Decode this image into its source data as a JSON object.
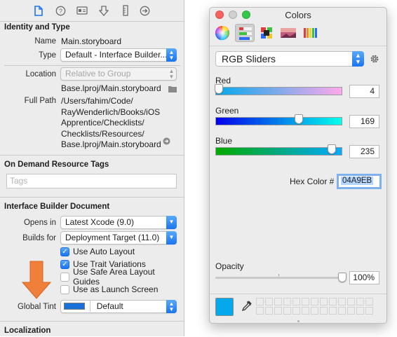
{
  "inspector": {
    "identity": {
      "header": "Identity and Type",
      "name_label": "Name",
      "name_value": "Main.storyboard",
      "type_label": "Type",
      "type_value": "Default - Interface Builder...",
      "location_label": "Location",
      "location_value": "Relative to Group",
      "location_path": "Base.lproj/Main.storyboard",
      "fullpath_label": "Full Path",
      "fullpath_lines": [
        "/Users/fahim/Code/",
        "RayWenderlich/Books/iOS",
        "Apprentice/Checklists/",
        "Checklists/Resources/",
        "Base.lproj/Main.storyboard"
      ]
    },
    "on_demand": {
      "header": "On Demand Resource Tags",
      "tags_placeholder": "Tags"
    },
    "ib_document": {
      "header": "Interface Builder Document",
      "opens_in_label": "Opens in",
      "opens_in_value": "Latest Xcode (9.0)",
      "builds_for_label": "Builds for",
      "builds_for_value": "Deployment Target (11.0)",
      "checkboxes": [
        {
          "label": "Use Auto Layout",
          "checked": true
        },
        {
          "label": "Use Trait Variations",
          "checked": true
        },
        {
          "label": "Use Safe Area Layout Guides",
          "checked": false
        },
        {
          "label": "Use as Launch Screen",
          "checked": false
        }
      ],
      "global_tint_label": "Global Tint",
      "global_tint_value": "Default",
      "global_tint_color": "#1a6fd8"
    },
    "localization": {
      "header": "Localization"
    }
  },
  "colors_window": {
    "title": "Colors",
    "mode": "RGB Sliders",
    "sliders": [
      {
        "label": "Red",
        "value": "4",
        "fraction": 0.016
      },
      {
        "label": "Green",
        "value": "169",
        "fraction": 0.663
      },
      {
        "label": "Blue",
        "value": "235",
        "fraction": 0.922
      }
    ],
    "hex_label": "Hex Color #",
    "hex_value": "04A9EB",
    "opacity_label": "Opacity",
    "opacity_value": "100%",
    "opacity_fraction": 1.0,
    "current_color": "#04a9eb"
  },
  "accent_color": "#1a74f0",
  "annotation_arrow_color": "#f07f3c"
}
